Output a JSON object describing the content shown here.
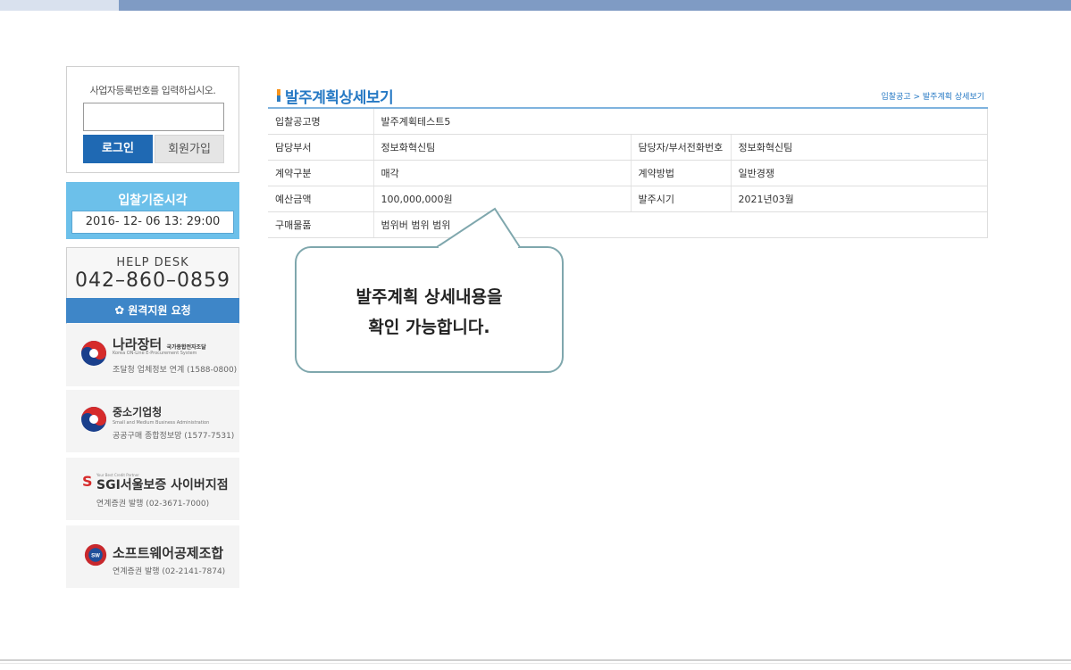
{
  "sidebar": {
    "login": {
      "prompt": "사업자등록번호를 입력하십시오.",
      "input_value": "",
      "login_label": "로그인",
      "join_label": "회원가입"
    },
    "time": {
      "title": "입찰기준시각",
      "value": "2016- 12- 06  13: 29:00"
    },
    "help": {
      "title": "HELP DESK",
      "phone": "042–860–0859",
      "remote_label": "원격지원 요청"
    },
    "partners": [
      {
        "name": "나라장터",
        "name_suffix": "국가종합전자조달",
        "sub": "Korea ON-Line E-Procurement System",
        "contact": "조달청 업체정보 연계 (1588-0800)",
        "logo_color": "#1a3f8c"
      },
      {
        "name": "중소기업청",
        "sub": "Small and Medium Business Administration",
        "contact": "공공구매 종합정보망 (1577-7531)",
        "logo_color": "#1a3f8c"
      },
      {
        "name": "SGI서울보증 사이버지점",
        "sub": "Your Best Credit Partner",
        "contact": "연계증권 발행 (02-3671-7000)",
        "logo_color": "#d62b2b"
      },
      {
        "name": "소프트웨어공제조합",
        "sub": "",
        "contact": "연계증권 발행 (02-2141-7874)",
        "logo_color": "#c8282d"
      }
    ]
  },
  "main": {
    "title": "발주계획상세보기",
    "breadcrumb": "입찰공고 > 발주계획 상세보기",
    "rows": {
      "r1": {
        "label": "입찰공고명",
        "value": "발주계획테스트5"
      },
      "r2": {
        "label": "담당부서",
        "value": "정보화혁신팀",
        "label2": "담당자/부서전화번호",
        "value2": "정보화혁신팀"
      },
      "r3": {
        "label": "계약구분",
        "value": "매각",
        "label2": "계약방법",
        "value2": "일반경쟁"
      },
      "r4": {
        "label": "예산금액",
        "value": "100,000,000원",
        "label2": "발주시기",
        "value2": "2021년03월"
      },
      "r5": {
        "label": "구매물품",
        "value": "범위버 범위 범위"
      }
    },
    "callout": {
      "line1": "발주계획 상세내용을",
      "line2": "확인 가능합니다."
    }
  },
  "colors": {
    "accent": "#2679c4",
    "login_button": "#1f69b3",
    "time_box": "#6cc0ea",
    "remote_bar": "#3e86c8",
    "topbar": "#7f9bc4"
  }
}
